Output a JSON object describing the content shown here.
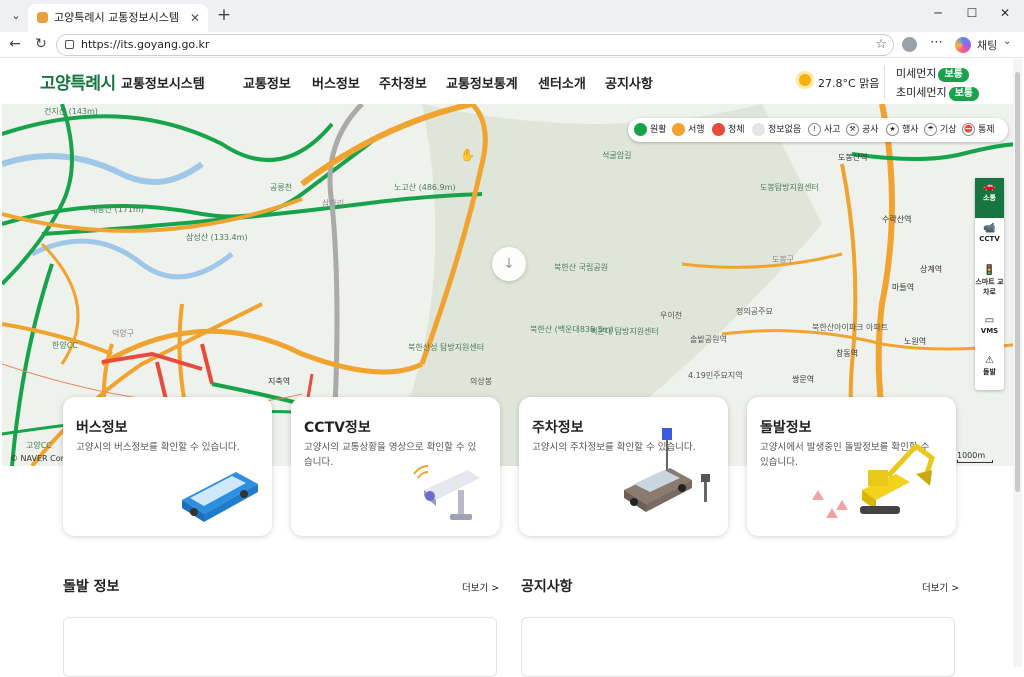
{
  "browser": {
    "tab_title": "고양특례시 교통정보시스템 - 메인",
    "url": "https://its.goyang.go.kr",
    "chat_label": "채팅"
  },
  "header": {
    "logo_main": "고양특례시",
    "logo_sub": "교통정보시스템",
    "nav": [
      "교통정보",
      "버스정보",
      "주차정보",
      "교통정보통계",
      "센터소개",
      "공지사항"
    ],
    "weather": {
      "temp": "27.8°C",
      "condition": "맑음"
    },
    "dust": [
      {
        "label": "미세먼지",
        "status": "보통"
      },
      {
        "label": "초미세먼지",
        "status": "보통"
      }
    ]
  },
  "map": {
    "legend": [
      {
        "label": "원활",
        "color": "#17a34a"
      },
      {
        "label": "서행",
        "color": "#f0a32e"
      },
      {
        "label": "정체",
        "color": "#e84b3c"
      },
      {
        "label": "정보없음",
        "color": "#e5e5e5"
      },
      {
        "label": "사고",
        "icon": "accident-icon"
      },
      {
        "label": "공사",
        "icon": "construction-icon"
      },
      {
        "label": "행사",
        "icon": "event-icon"
      },
      {
        "label": "기상",
        "icon": "weather-icon"
      },
      {
        "label": "통제",
        "icon": "control-icon"
      }
    ],
    "side_panel": [
      {
        "label": "소통",
        "icon": "car-icon",
        "active": true
      },
      {
        "label": "CCTV",
        "icon": "cctv-icon",
        "active": false
      },
      {
        "label": "스마트 교차로",
        "icon": "smart-intersection-icon",
        "active": false
      },
      {
        "label": "VMS",
        "icon": "vms-icon",
        "active": false
      },
      {
        "label": "돌발",
        "icon": "incident-icon",
        "active": false
      }
    ],
    "place_labels": [
      "건지산 (143m)",
      "매봉산 (171m)",
      "노고산 (486.9m)",
      "삼하리",
      "공릉천",
      "석굴암길",
      "도봉산역",
      "도봉탐방지원센터",
      "북한산 국립공원",
      "북한산 (백운대835.5m)",
      "백운대 탐방지원센터",
      "북한산성 탐방지원센터",
      "우이천",
      "솔밭공원역",
      "4.19민주묘지역",
      "정의공주묘",
      "북한산아이파크 아파트",
      "창동역",
      "노원역",
      "쌍문역",
      "삼성산 (133.4m)",
      "한양CC",
      "고양CC",
      "덕양구",
      "지축역",
      "의상봉",
      "도봉구",
      "수락산역",
      "마들역",
      "상계역"
    ],
    "copyright": "© NAVER Corp.",
    "scale": "1000m"
  },
  "cards": [
    {
      "title": "버스정보",
      "desc": "고양시의 버스정보를 확인할 수 있습니다.",
      "illustration": "bus-icon"
    },
    {
      "title": "CCTV정보",
      "desc": "고양시의 교통상황을 영상으로 확인할 수 있습니다.",
      "illustration": "cctv-camera-icon"
    },
    {
      "title": "주차정보",
      "desc": "고양시의 주차정보를 확인할 수 있습니다.",
      "illustration": "parking-car-icon"
    },
    {
      "title": "돌발정보",
      "desc": "고양시에서 발생중인 돌발정보를 확인할 수 있습니다.",
      "illustration": "excavator-icon"
    }
  ],
  "sections": {
    "incident": {
      "title": "돌발 정보",
      "more": "더보기 >"
    },
    "notice": {
      "title": "공지사항",
      "more": "더보기 >"
    }
  }
}
